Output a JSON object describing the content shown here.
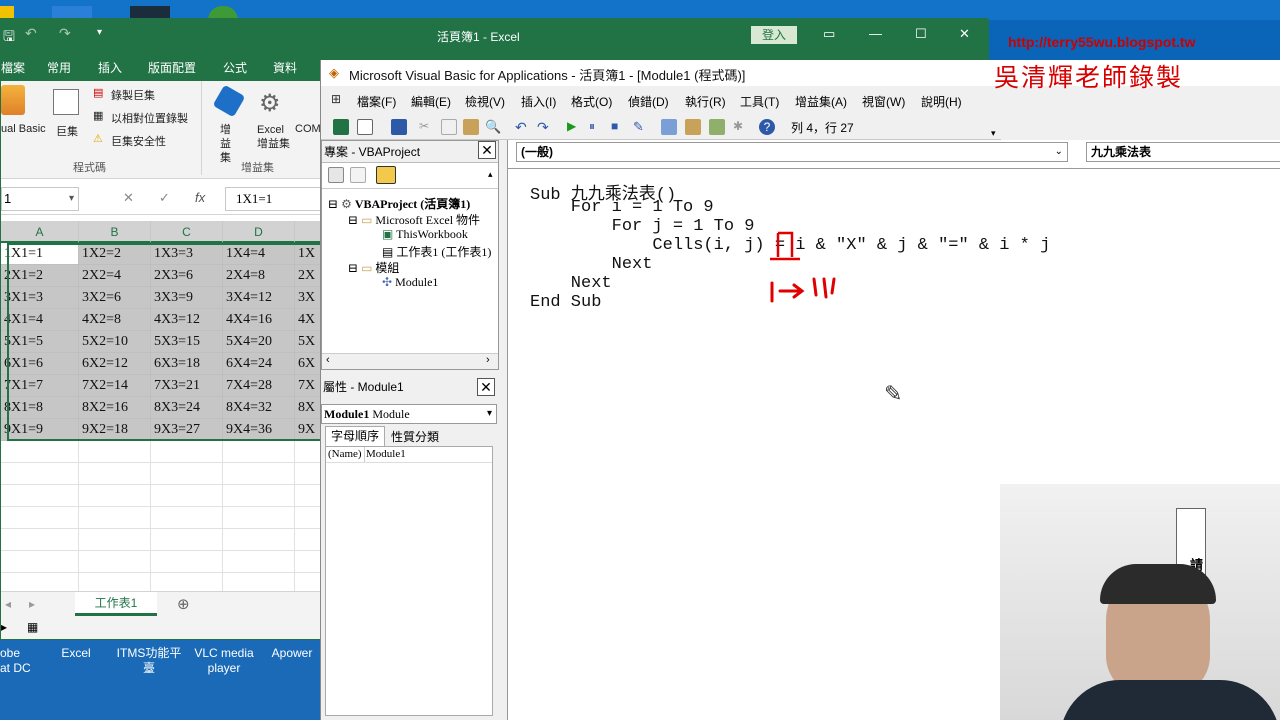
{
  "excel": {
    "title": "活頁簿1  -  Excel",
    "signin": "登入",
    "tabs": [
      "檔案",
      "常用",
      "插入",
      "版面配置",
      "公式",
      "資料"
    ],
    "ribbon": {
      "visual_basic": "ual Basic",
      "macros": "巨集",
      "record_macro": "錄製巨集",
      "relative_ref": "以相對位置錄製",
      "macro_security": "巨集安全性",
      "code_group": "程式碼",
      "addins": "增益集",
      "excel_addins": "Excel 增益集",
      "com_addins": "COM",
      "addins_group": "增益集"
    },
    "name_box": "1",
    "fx": "fx",
    "formula": "1X1=1",
    "columns": [
      "A",
      "B",
      "C",
      "D",
      ""
    ],
    "rows": [
      [
        "1X1=1",
        "1X2=2",
        "1X3=3",
        "1X4=4",
        "1X"
      ],
      [
        "2X1=2",
        "2X2=4",
        "2X3=6",
        "2X4=8",
        "2X"
      ],
      [
        "3X1=3",
        "3X2=6",
        "3X3=9",
        "3X4=12",
        "3X"
      ],
      [
        "4X1=4",
        "4X2=8",
        "4X3=12",
        "4X4=16",
        "4X"
      ],
      [
        "5X1=5",
        "5X2=10",
        "5X3=15",
        "5X4=20",
        "5X"
      ],
      [
        "6X1=6",
        "6X2=12",
        "6X3=18",
        "6X4=24",
        "6X"
      ],
      [
        "7X1=7",
        "7X2=14",
        "7X3=21",
        "7X4=28",
        "7X"
      ],
      [
        "8X1=8",
        "8X2=16",
        "8X3=24",
        "8X4=32",
        "8X"
      ],
      [
        "9X1=9",
        "9X2=18",
        "9X3=27",
        "9X4=36",
        "9X"
      ]
    ],
    "sheet_tab": "工作表1",
    "taskbar": [
      "obe\nat DC",
      "Excel",
      "ITMS功能平\n臺",
      "VLC media\nplayer",
      "Apower"
    ]
  },
  "vba": {
    "title": "Microsoft Visual Basic for Applications - 活頁簿1 - [Module1 (程式碼)]",
    "menu": [
      "檔案(F)",
      "編輯(E)",
      "檢視(V)",
      "插入(I)",
      "格式(O)",
      "偵錯(D)",
      "執行(R)",
      "工具(T)",
      "增益集(A)",
      "視窗(W)",
      "說明(H)"
    ],
    "cursor_pos": "列 4，行 27",
    "project_title": "專案 - VBAProject",
    "tree": {
      "root": "VBAProject (活頁簿1)",
      "excel_objects": "Microsoft Excel 物件",
      "this_workbook": "ThisWorkbook",
      "sheet1": "工作表1 (工作表1)",
      "modules": "模組",
      "module1": "Module1"
    },
    "props_title": "屬性 - Module1",
    "props_object": "Module1",
    "props_object_type": "Module",
    "props_tab_alpha": "字母順序",
    "props_tab_cat": "性質分類",
    "props_name_key": "(Name)",
    "props_name_val": "Module1",
    "combo_object": "(一般)",
    "combo_proc": "九九乘法表",
    "code": [
      "Sub 九九乘法表()",
      "    For i = 1 To 9",
      "        For j = 1 To 9",
      "            Cells(i, j) = i & \"X\" & j & \"=\" & i * j",
      "        Next",
      "    Next",
      "End Sub"
    ],
    "annotation": "I→\"I\""
  },
  "overlay": {
    "url": "http://terry55wu.blogspot.tw",
    "watermark": "吳清輝老師錄製",
    "webcam_sign": "請勿在教室"
  }
}
